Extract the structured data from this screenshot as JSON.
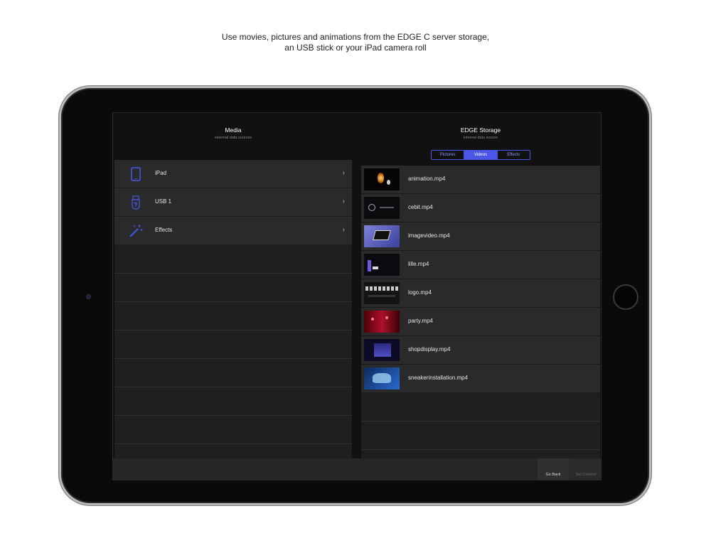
{
  "caption": {
    "line1": "Use movies, pictures and animations from the EDGE C server storage,",
    "line2": "an USB stick or your iPad camera roll"
  },
  "media_panel": {
    "title": "Media",
    "subtitle": "external data sources",
    "sources": [
      {
        "label": "iPad",
        "icon": "tablet-icon"
      },
      {
        "label": "USB 1",
        "icon": "usb-icon"
      },
      {
        "label": "Effects",
        "icon": "magic-wand-icon"
      }
    ]
  },
  "storage_panel": {
    "title": "EDGE Storage",
    "subtitle": "internal data source",
    "tabs": [
      {
        "label": "Pictures",
        "active": false
      },
      {
        "label": "Videos",
        "active": true
      },
      {
        "label": "Effects",
        "active": false
      }
    ],
    "files": [
      {
        "name": "animation.mp4"
      },
      {
        "name": "cebit.mp4"
      },
      {
        "name": "imagevideo.mp4"
      },
      {
        "name": "lille.mp4"
      },
      {
        "name": "logo.mp4"
      },
      {
        "name": "party.mp4"
      },
      {
        "name": "shopdisplay.mp4"
      },
      {
        "name": "sneakerinstallation.mp4"
      }
    ]
  },
  "bottom_bar": {
    "go_back": "Go Back",
    "set_content": "Set Content"
  },
  "colors": {
    "accent": "#4a56e8",
    "background": "#111111",
    "row": "#2a2a2a"
  }
}
